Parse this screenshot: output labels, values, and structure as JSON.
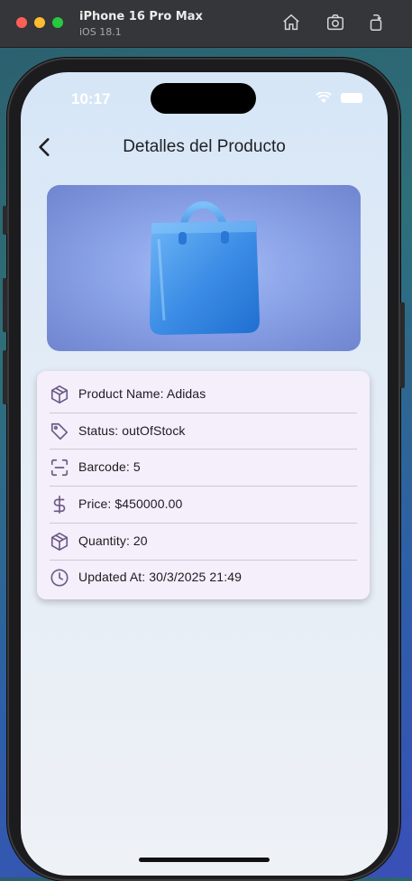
{
  "simulator": {
    "device_name": "iPhone 16 Pro Max",
    "os_version": "iOS 18.1"
  },
  "status_bar": {
    "time": "10:17"
  },
  "app": {
    "title": "Detalles del Producto",
    "details": [
      {
        "icon": "box-icon",
        "text": "Product Name: Adidas"
      },
      {
        "icon": "tag-icon",
        "text": "Status: outOfStock"
      },
      {
        "icon": "barcode-scan-icon",
        "text": "Barcode: 5"
      },
      {
        "icon": "dollar-icon",
        "text": "Price: $450000.00"
      },
      {
        "icon": "box-icon",
        "text": "Quantity: 20"
      },
      {
        "icon": "clock-icon",
        "text": "Updated At: 30/3/2025 21:49"
      }
    ]
  },
  "colors": {
    "icon": "#6b5a86",
    "card_bg": "#f5eefb",
    "bag": "#3d8ee6"
  }
}
